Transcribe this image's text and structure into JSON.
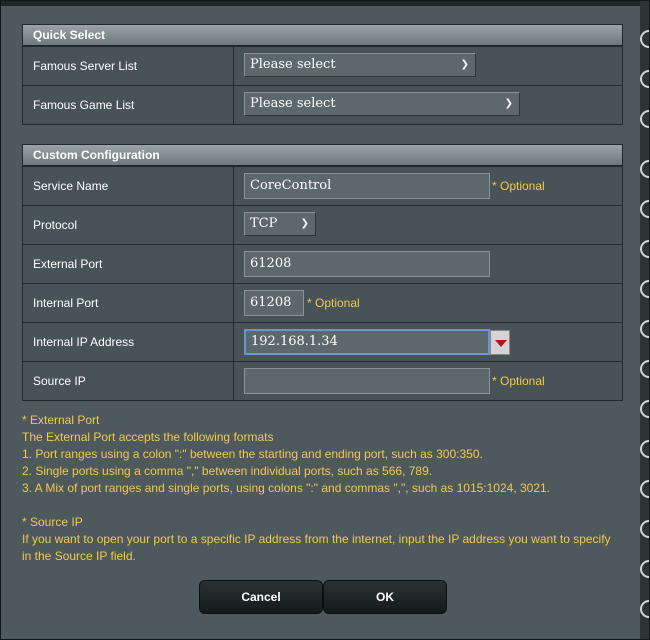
{
  "quick_select": {
    "header": "Quick Select",
    "rows": [
      {
        "label": "Famous Server List",
        "value": "Please select"
      },
      {
        "label": "Famous Game List",
        "value": "Please select"
      }
    ]
  },
  "custom": {
    "header": "Custom Configuration",
    "service_name": {
      "label": "Service Name",
      "value": "CoreControl",
      "note": "* Optional"
    },
    "protocol": {
      "label": "Protocol",
      "value": "TCP"
    },
    "external_port": {
      "label": "External Port",
      "value": "61208"
    },
    "internal_port": {
      "label": "Internal Port",
      "value": "61208",
      "note": "* Optional"
    },
    "internal_ip": {
      "label": "Internal IP Address",
      "value": "192.168.1.34"
    },
    "source_ip": {
      "label": "Source IP",
      "value": "",
      "note": "* Optional"
    }
  },
  "notes": {
    "ext_title": "* External Port",
    "ext_intro": "The External Port accepts the following formats",
    "ext_1": "1. Port ranges using a colon \":\" between the starting and ending port, such as 300:350.",
    "ext_2": "2. Single ports using a comma \",\" between individual ports, such as 566, 789.",
    "ext_3": "3. A Mix of port ranges and single ports, using colons \":\" and commas \",\", such as 1015:1024, 3021.",
    "src_title": "* Source IP",
    "src_text": "If you want to open your port to a specific IP address from the internet, input the IP address you want to specify in the Source IP field."
  },
  "buttons": {
    "cancel": "Cancel",
    "ok": "OK"
  },
  "icons": {
    "select_arrow": "chevron-down-icon",
    "ip_dropdown": "triangle-down-icon"
  },
  "colors": {
    "optional_text": "#f2c94c",
    "focus_border": "#6e94d6",
    "panel_bg": "#4d595d"
  }
}
